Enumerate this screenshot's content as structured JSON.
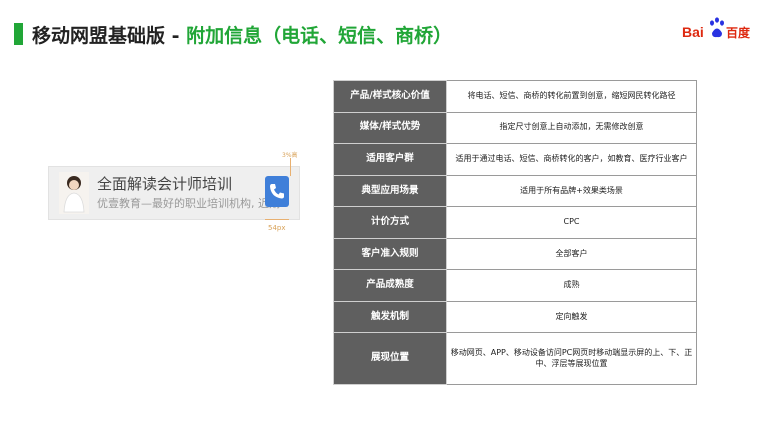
{
  "title": {
    "main": "移动网盟基础版 - ",
    "highlight": "附加信息（电话、短信、商桥）"
  },
  "logo": {
    "bai": "Bai",
    "du": "百度"
  },
  "ad_preview": {
    "title": "全面解读会计师培训",
    "description": "优壹教育—最好的职业培训机构, 近期",
    "dimension_top": "3%高",
    "dimension_bottom": "54px",
    "phone_icon": "phone-icon"
  },
  "table": {
    "rows": [
      {
        "key": "产品/样式核心价值",
        "value": "将电话、短信、商桥的转化前置到创意，缩短网民转化路径"
      },
      {
        "key": "媒体/样式优势",
        "value": "指定尺寸创意上自动添加，无需修改创意"
      },
      {
        "key": "适用客户群",
        "value": "适用于通过电话、短信、商桥转化的客户，如教育、医疗行业客户"
      },
      {
        "key": "典型应用场景",
        "value": "适用于所有品牌+效果类场景"
      },
      {
        "key": "计价方式",
        "value": "CPC"
      },
      {
        "key": "客户准入规则",
        "value": "全部客户"
      },
      {
        "key": "产品成熟度",
        "value": "成熟"
      },
      {
        "key": "触发机制",
        "value": "定向触发"
      },
      {
        "key": "展现位置",
        "value": "移动网页、APP、移动设备访问PC网页时移动端显示屏的上、下、正中、浮层等展现位置"
      }
    ]
  },
  "colors": {
    "accent": "#21a637",
    "table_key_bg": "#5f5f5f",
    "phone_button": "#3f7fd9",
    "logo_red": "#de2910"
  }
}
